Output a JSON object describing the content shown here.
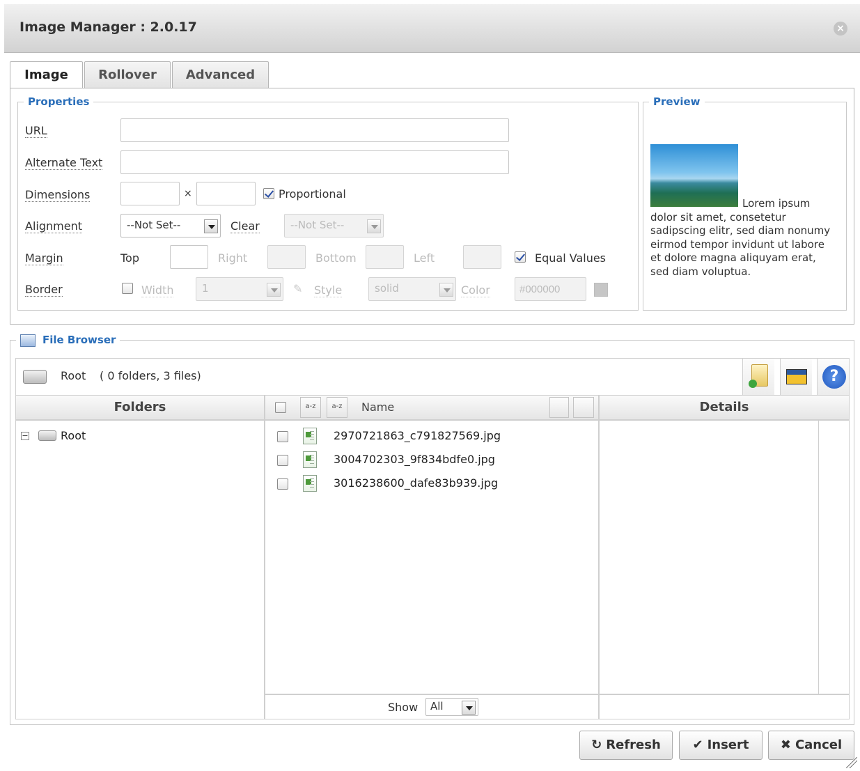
{
  "window": {
    "title": "Image Manager : 2.0.17"
  },
  "tabs": [
    {
      "label": "Image",
      "active": true
    },
    {
      "label": "Rollover",
      "active": false
    },
    {
      "label": "Advanced",
      "active": false
    }
  ],
  "properties": {
    "legend": "Properties",
    "url_label": "URL",
    "url_value": "",
    "alt_label": "Alternate Text",
    "alt_value": "",
    "dimensions_label": "Dimensions",
    "dim_times": "×",
    "width_value": "",
    "height_value": "",
    "proportional_label": "Proportional",
    "proportional_checked": true,
    "alignment_label": "Alignment",
    "alignment_value": "--Not Set--",
    "clear_label": "Clear",
    "clear_value": "--Not Set--",
    "margin_label": "Margin",
    "margin_top_label": "Top",
    "margin_right_label": "Right",
    "margin_bottom_label": "Bottom",
    "margin_left_label": "Left",
    "equal_values_label": "Equal Values",
    "equal_values_checked": true,
    "border_label": "Border",
    "border_checked": false,
    "border_width_label": "Width",
    "border_width_value": "1",
    "border_style_label": "Style",
    "border_style_value": "solid",
    "border_color_label": "Color",
    "border_color_value": "#000000"
  },
  "preview": {
    "legend": "Preview",
    "text": "Lorem ipsum dolor sit amet, consetetur sadipscing elitr, sed diam nonumy eirmod tempor invidunt ut labore et dolore magna aliquyam erat, sed diam voluptua."
  },
  "file_browser": {
    "legend": "File Browser",
    "path_label": "Root",
    "path_summary": "( 0 folders, 3 files)",
    "folders_header": "Folders",
    "name_header": "Name",
    "details_header": "Details",
    "sort_asc_label": "a-z",
    "sort_desc_label": "a-z",
    "tree_root": "Root",
    "tree_toggle": "−",
    "files": [
      "2970721863_c791827569.jpg",
      "3004702303_9f834bdfe0.jpg",
      "3016238600_dafe83b939.jpg"
    ],
    "show_label": "Show",
    "show_value": "All"
  },
  "buttons": {
    "refresh": "Refresh",
    "insert": "Insert",
    "cancel": "Cancel"
  },
  "colors": {
    "accent": "#2a6eb9",
    "help_blue": "#2d6bd1"
  }
}
